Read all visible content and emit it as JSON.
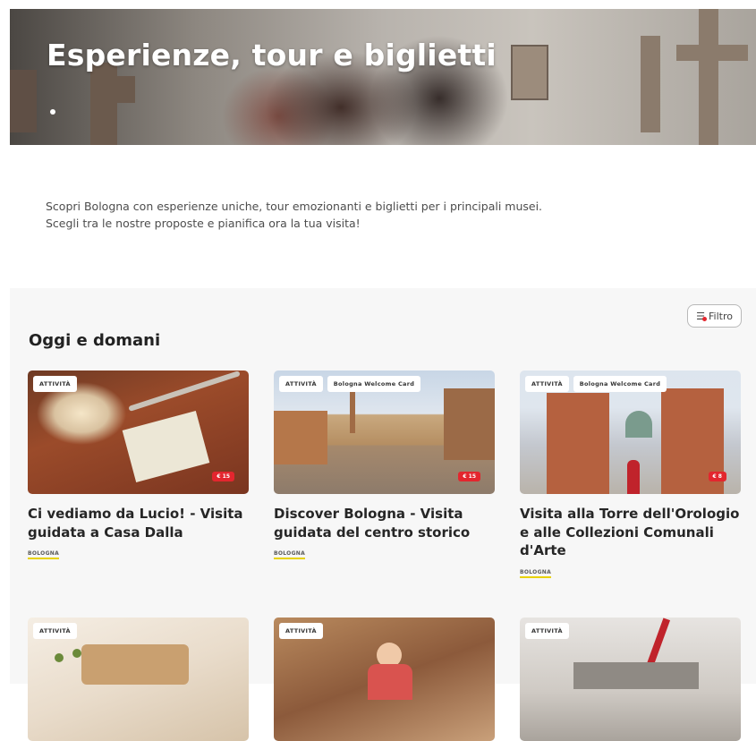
{
  "hero": {
    "title": "Esperienze, tour e biglietti"
  },
  "intro": {
    "line1": "Scopri Bologna con esperienze uniche, tour emozionanti e biglietti per i principali musei.",
    "line2": "Scegli tra le nostre proposte e pianifica ora la tua visita!"
  },
  "section": {
    "title": "Oggi e domani",
    "filter_label": "Filtro",
    "filter_icon": "sliders-icon"
  },
  "cards": [
    {
      "badges": [
        "ATTIVITÀ"
      ],
      "price": "€ 15",
      "title": "Ci vediamo da Lucio! - Visita guidata a Casa Dalla",
      "city": "BOLOGNA"
    },
    {
      "badges": [
        "ATTIVITÀ",
        "Bologna Welcome Card"
      ],
      "price": "€ 15",
      "title": "Discover Bologna - Visita guidata del centro storico",
      "city": "BOLOGNA"
    },
    {
      "badges": [
        "ATTIVITÀ",
        "Bologna Welcome Card"
      ],
      "price": "€ 8",
      "title": "Visita alla Torre dell'Orologio e alle Collezioni Comunali d'Arte",
      "city": "BOLOGNA"
    },
    {
      "badges": [
        "ATTIVITÀ"
      ]
    },
    {
      "badges": [
        "ATTIVITÀ"
      ]
    },
    {
      "badges": [
        "ATTIVITÀ"
      ]
    }
  ],
  "colors": {
    "accent_red": "#e3262e",
    "city_underline": "#e8d200",
    "section_bg": "#f7f7f7"
  }
}
